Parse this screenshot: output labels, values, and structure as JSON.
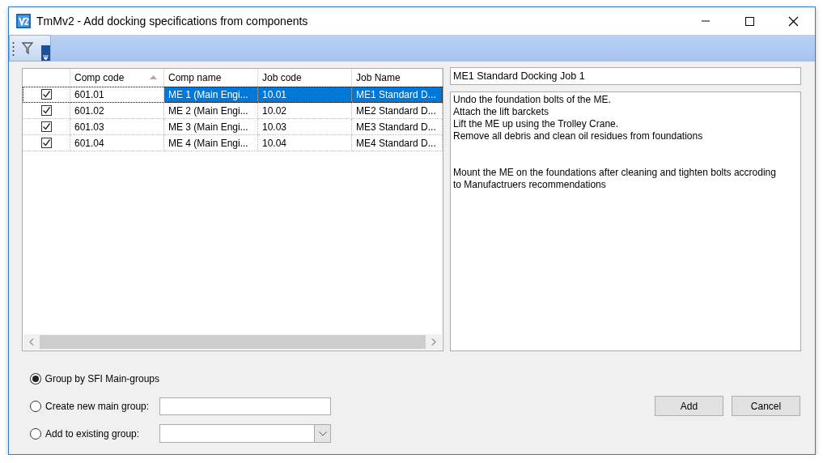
{
  "window": {
    "title": "TmMv2 - Add docking specifications from components"
  },
  "table": {
    "columns": [
      {
        "label": "Comp code",
        "sorted": true
      },
      {
        "label": "Comp name",
        "sorted": false
      },
      {
        "label": "Job code",
        "sorted": false
      },
      {
        "label": "Job Name",
        "sorted": false
      }
    ],
    "rows": [
      {
        "checked": true,
        "selected": true,
        "cells": [
          "601.01",
          "ME 1 (Main Engi...",
          "10.01",
          "ME1 Standard D..."
        ]
      },
      {
        "checked": true,
        "selected": false,
        "cells": [
          "601.02",
          "ME 2 (Main Engi...",
          "10.02",
          "ME2 Standard D..."
        ]
      },
      {
        "checked": true,
        "selected": false,
        "cells": [
          "601.03",
          "ME 3 (Main Engi...",
          "10.03",
          "ME3 Standard D..."
        ]
      },
      {
        "checked": true,
        "selected": false,
        "cells": [
          "601.04",
          "ME 4 (Main Engi...",
          "10.04",
          "ME4 Standard D..."
        ]
      }
    ]
  },
  "details": {
    "job_name": "ME1 Standard Docking Job 1",
    "description": [
      [
        "Undo the foundation bolts of the ME.",
        "Attach the lift barckets",
        "Lift the ME up using the Trolley Crane.",
        "Remove all debris and clean oil residues from foundations"
      ],
      [
        "Mount the ME on the foundations after cleaning and tighten bolts accroding to Manufactruers recommendations"
      ]
    ]
  },
  "group_options": [
    {
      "kind": "plain",
      "label": "Group by SFI Main-groups",
      "selected": true
    },
    {
      "kind": "text",
      "label": "Create new main group:",
      "selected": false
    },
    {
      "kind": "combo",
      "label": "Add to existing group:",
      "selected": false
    }
  ],
  "buttons": [
    "Add",
    "Cancel"
  ]
}
